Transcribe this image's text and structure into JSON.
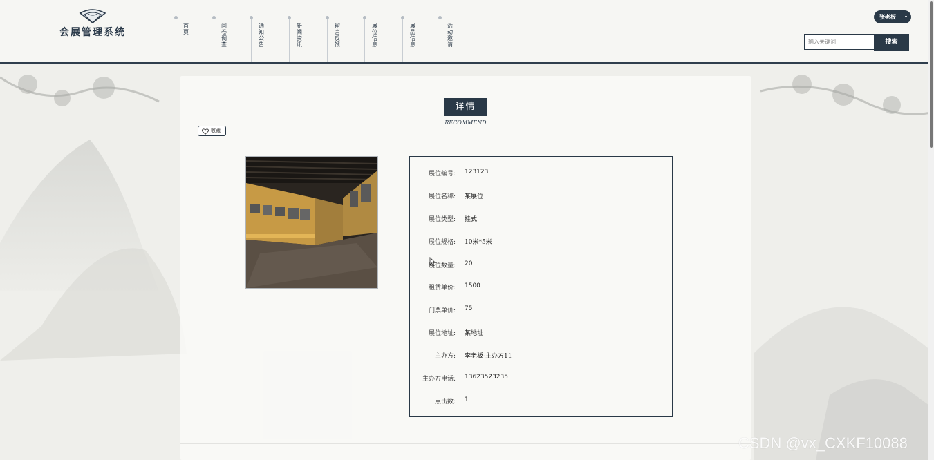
{
  "colors": {
    "primary": "#2a3947",
    "header_bg": "#f6f6f3",
    "page_bg": "#eeeeea"
  },
  "header": {
    "logo_icon": "fan-icon",
    "app_title": "会展管理系统",
    "nav": [
      {
        "label": "首页"
      },
      {
        "label": "问卷调查"
      },
      {
        "label": "通知公告"
      },
      {
        "label": "新闻资讯"
      },
      {
        "label": "留言反馈"
      },
      {
        "label": "展位信息"
      },
      {
        "label": "展品信息"
      },
      {
        "label": "活动邀请"
      }
    ],
    "user": {
      "name": "张老板",
      "caret": "▾"
    },
    "search": {
      "placeholder": "输入关键词",
      "button_label": "搜索"
    }
  },
  "detail": {
    "title": "详情",
    "subtitle": "RECOMMEND",
    "favorite_label": "收藏",
    "fields": [
      {
        "label": "展位编号:",
        "value": "123123"
      },
      {
        "label": "展位名称:",
        "value": "某展位"
      },
      {
        "label": "展位类型:",
        "value": "挂式"
      },
      {
        "label": "展位规格:",
        "value": "10米*5米"
      },
      {
        "label": "展位数量:",
        "value": "20"
      },
      {
        "label": "租赁单价:",
        "value": "1500"
      },
      {
        "label": "门票单价:",
        "value": "75"
      },
      {
        "label": "展位地址:",
        "value": "某地址"
      },
      {
        "label": "主办方:",
        "value": "李老板-主办方11"
      },
      {
        "label": "主办方电话:",
        "value": "13623523235"
      },
      {
        "label": "点击数:",
        "value": "1"
      }
    ]
  },
  "watermark": "CSDN @vx_CXKF10088"
}
